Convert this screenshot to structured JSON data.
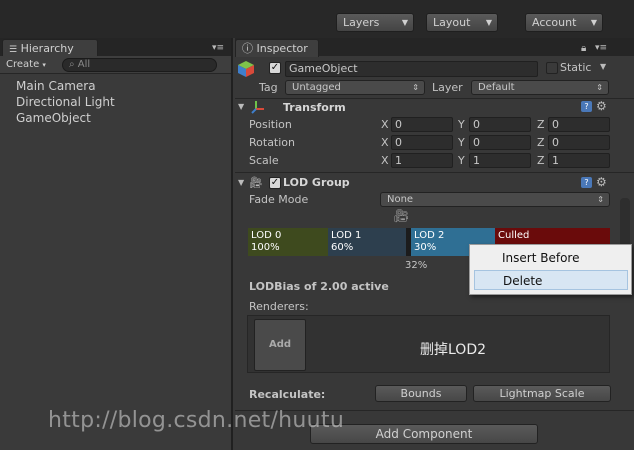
{
  "toolbar": {
    "layers": "Layers",
    "layout": "Layout",
    "account": "Account"
  },
  "hierarchy": {
    "tab": "Hierarchy",
    "create": "Create",
    "search_placeholder": "All",
    "items": [
      "Main Camera",
      "Directional Light",
      "GameObject"
    ]
  },
  "inspector": {
    "tab": "Inspector",
    "object_name": "GameObject",
    "static_label": "Static",
    "tag_label": "Tag",
    "tag_value": "Untagged",
    "layer_label": "Layer",
    "layer_value": "Default",
    "transform": {
      "title": "Transform",
      "position": {
        "label": "Position",
        "x": "0",
        "y": "0",
        "z": "0"
      },
      "rotation": {
        "label": "Rotation",
        "x": "0",
        "y": "0",
        "z": "0"
      },
      "scale": {
        "label": "Scale",
        "x": "1",
        "y": "1",
        "z": "1"
      }
    },
    "lod_group": {
      "title": "LOD Group",
      "fade_mode_label": "Fade Mode",
      "fade_mode_value": "None",
      "lods": [
        {
          "name": "LOD 0",
          "pct": "100%",
          "color": "#3e4a1e"
        },
        {
          "name": "LOD 1",
          "pct": "60%",
          "color": "#2d3f4e"
        },
        {
          "name": "LOD 2",
          "pct": "30%",
          "color": "#2f6f94"
        },
        {
          "name": "Culled",
          "pct": "",
          "color": "#6a0b0b"
        }
      ],
      "marker_pct": "32%",
      "bias_text": "LODBias of 2.00 active",
      "renderers_label": "Renderers:",
      "add_label": "Add",
      "note": "删掉LOD2",
      "recalculate_label": "Recalculate:",
      "bounds_button": "Bounds",
      "lightmap_button": "Lightmap Scale"
    },
    "add_component": "Add Component",
    "axis": {
      "x": "X",
      "y": "Y",
      "z": "Z"
    }
  },
  "context_menu": {
    "items": [
      "Insert Before",
      "Delete"
    ]
  },
  "watermark": "http://blog.csdn.net/huutu"
}
